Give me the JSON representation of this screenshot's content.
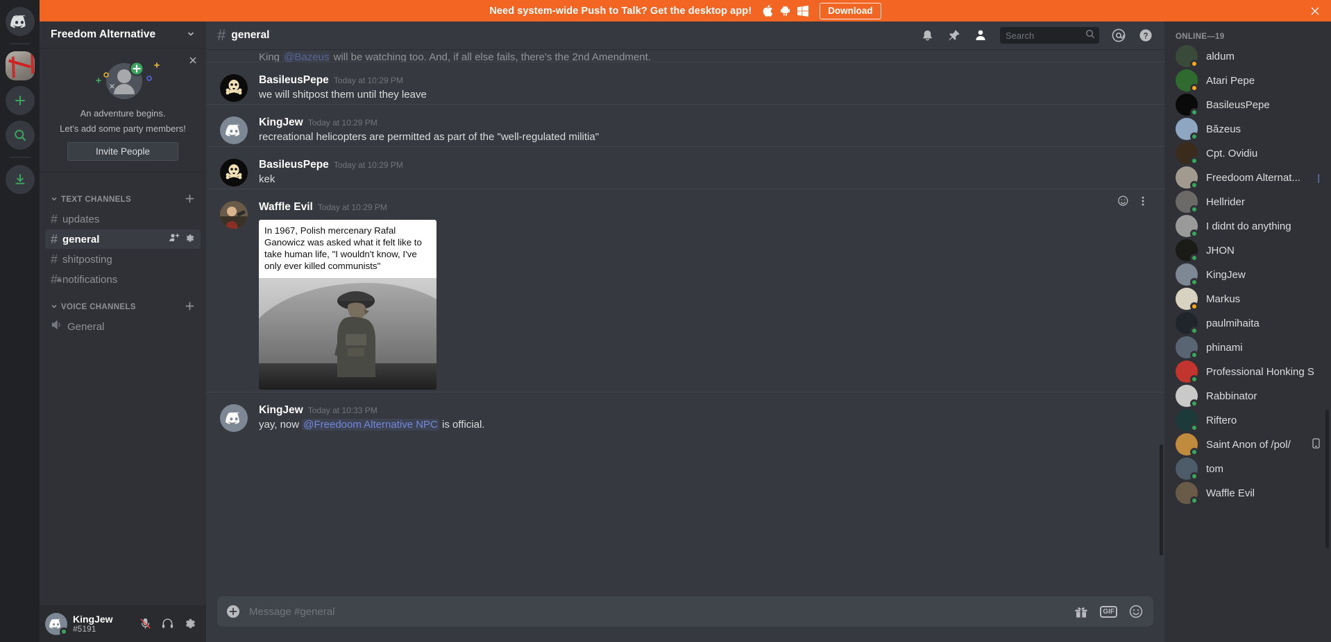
{
  "banner": {
    "text": "Need system-wide Push to Talk? Get the desktop app!",
    "download_label": "Download",
    "bg_color": "#f26522",
    "os_icons": [
      "apple-icon",
      "android-icon",
      "windows-icon"
    ],
    "close_icon": "close-icon"
  },
  "guilds": {
    "home_icon": "discord-home-icon",
    "add_label": "+",
    "search_icon": "explore-search-icon",
    "download_icon": "download-apps-icon",
    "active_server": "Freedom Alternative"
  },
  "sidebar": {
    "server_name": "Freedom Alternative",
    "invite_card": {
      "line1": "An adventure begins.",
      "line2": "Let's add some party members!",
      "button": "Invite People",
      "close_icon": "close-icon"
    },
    "categories": [
      {
        "label": "TEXT CHANNELS",
        "add_icon": "plus-icon",
        "channels": [
          {
            "name": "updates",
            "active": false,
            "locked": false
          },
          {
            "name": "general",
            "active": true,
            "locked": false,
            "actions": [
              "invite-icon",
              "settings-icon"
            ]
          },
          {
            "name": "shitposting",
            "active": false,
            "locked": false
          },
          {
            "name": "notifications",
            "active": false,
            "locked": true
          }
        ]
      },
      {
        "label": "VOICE CHANNELS",
        "add_icon": "plus-icon",
        "channels": [
          {
            "name": "General",
            "active": false,
            "voice": true
          }
        ]
      }
    ],
    "user_panel": {
      "username": "KingJew",
      "discriminator": "#5191",
      "status": "online",
      "mute_icon": "mic-muted-icon",
      "deafen_icon": "headphones-icon",
      "settings_icon": "gear-icon"
    }
  },
  "header": {
    "channel_name": "general",
    "hash_icon": "hash-icon",
    "icons": [
      "bell-icon",
      "pin-icon",
      "members-icon"
    ],
    "search": {
      "placeholder": "Search",
      "icon": "search-icon"
    },
    "mentions_icon": "mentions-at-icon",
    "help_icon": "help-question-icon"
  },
  "messages": {
    "cut_off_top": {
      "prefix": "King ",
      "mention": "@Bazeus",
      "suffix": " will be watching too. And, if all else fails, there's the 2nd Amendment."
    },
    "list": [
      {
        "author": "BasileusPepe",
        "timestamp": "Today at 10:29 PM",
        "text": "we will shitpost them until they leave",
        "avatar": "skull-crossbones-avatar"
      },
      {
        "author": "KingJew",
        "timestamp": "Today at 10:29 PM",
        "text": "recreational helicopters are permitted as part of the \"well-regulated militia\"",
        "avatar": "discord-default-avatar"
      },
      {
        "author": "BasileusPepe",
        "timestamp": "Today at 10:29 PM",
        "text": "kek",
        "avatar": "skull-crossbones-avatar"
      },
      {
        "author": "Waffle Evil",
        "timestamp": "Today at 10:29 PM",
        "text": "",
        "avatar": "photo-avatar",
        "attachment": {
          "quote": "In 1967, Polish mercenary Rafal Ganowicz was asked what it felt like to take human life, \"I wouldn't know, I've only ever killed communists\"",
          "image_alt": "black-and-white photo of a soldier in helmet on a hillside"
        },
        "hover_actions": [
          "add-reaction-icon",
          "more-options-icon"
        ]
      }
    ],
    "last": {
      "author": "KingJew",
      "timestamp": "Today at 10:33 PM",
      "prefix": "yay, now ",
      "mention": "@Freedoom Alternative NPC",
      "suffix": " is official.",
      "avatar": "discord-default-avatar"
    }
  },
  "composer": {
    "placeholder": "Message #general",
    "plus_icon": "add-attachment-icon",
    "gift_icon": "gift-icon",
    "gif_label": "GIF",
    "emoji_icon": "emoji-icon"
  },
  "members": {
    "category": "ONLINE—19",
    "list": [
      {
        "name": "aldum",
        "status": "idle",
        "color": "#3a4a3a"
      },
      {
        "name": "Atari Pepe",
        "status": "idle",
        "color": "#2f6b2f"
      },
      {
        "name": "BasileusPepe",
        "status": "online",
        "color": "#0a0a0a"
      },
      {
        "name": "Băzeus",
        "status": "online",
        "color": "#8fa6c2"
      },
      {
        "name": "Cpt. Ovidiu",
        "status": "online",
        "color": "#3b2b1d"
      },
      {
        "name": "Freedoom Alternat...",
        "status": "online",
        "color": "#a39a8f",
        "caret": "|"
      },
      {
        "name": "Hellrider",
        "status": "online",
        "color": "#6b6a68"
      },
      {
        "name": "I didnt do anything",
        "status": "online",
        "color": "#9a9a9a"
      },
      {
        "name": "JHON",
        "status": "online",
        "color": "#1a1a16"
      },
      {
        "name": "KingJew",
        "status": "online",
        "color": "#7e8794"
      },
      {
        "name": "Markus",
        "status": "idle",
        "color": "#d8d2c0"
      },
      {
        "name": "paulmihaita",
        "status": "online",
        "color": "#20252c"
      },
      {
        "name": "phinami",
        "status": "online",
        "color": "#5a6573"
      },
      {
        "name": "Professional Honking S",
        "status": "online",
        "color": "#c2352f"
      },
      {
        "name": "Rabbinator",
        "status": "online",
        "color": "#c9c9c9"
      },
      {
        "name": "Riftero",
        "status": "online",
        "color": "#1d3a3a"
      },
      {
        "name": "Saint Anon of /pol/",
        "status": "online",
        "color": "#c08b3c",
        "mobile": "mobile-icon"
      },
      {
        "name": "tom",
        "status": "online",
        "color": "#4e5b68"
      },
      {
        "name": "Waffle Evil",
        "status": "online",
        "color": "#6a5a48"
      }
    ],
    "status_colors": {
      "online": "#3ba55d",
      "idle": "#faa81a"
    }
  }
}
